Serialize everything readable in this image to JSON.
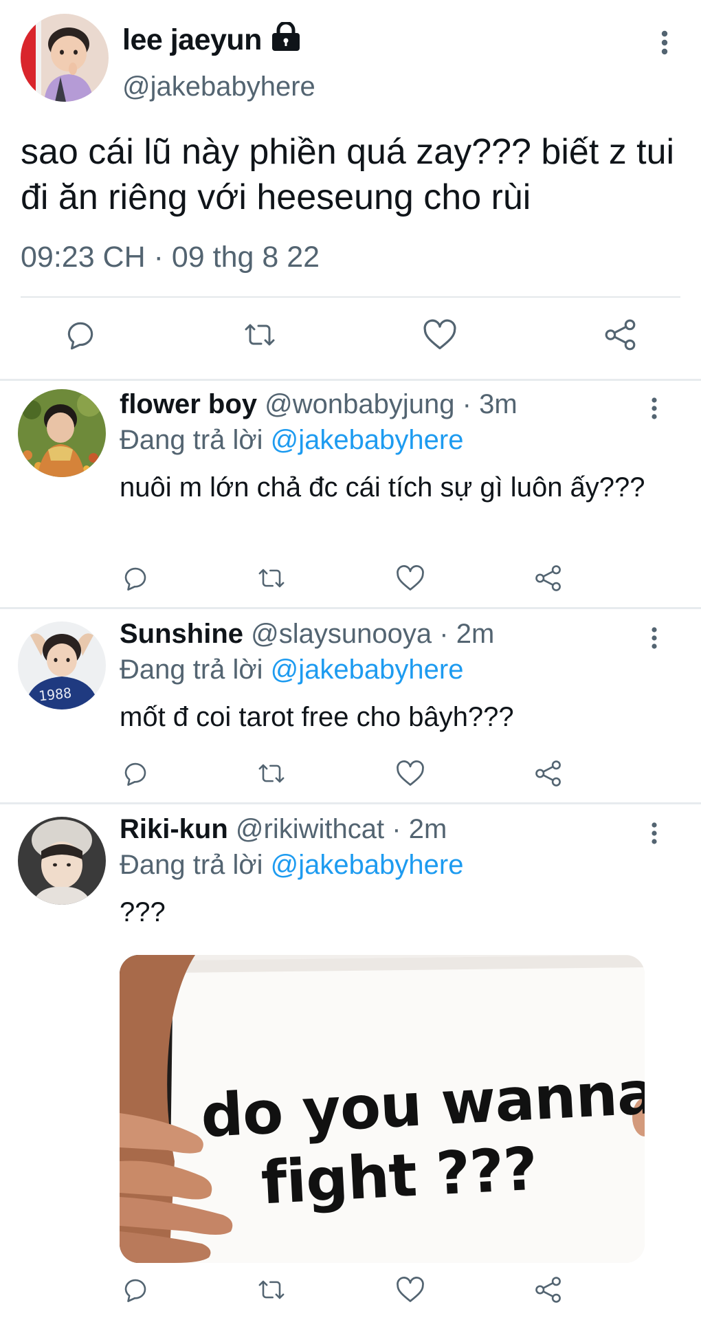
{
  "main_tweet": {
    "name": "lee jaeyun",
    "handle": "@jakebabyhere",
    "text": "sao cái lũ này phiền quá zay??? biết z tui đi ăn riêng với heeseung cho rùi",
    "timestamp": "09:23 CH · 09 thg 8 22",
    "icons": [
      "lock-icon",
      "more-icon",
      "reply-icon",
      "retweet-icon",
      "like-icon",
      "share-icon"
    ]
  },
  "replies": [
    {
      "name": "flower boy",
      "handle": "@wonbabyjung",
      "dot": "·",
      "time": "3m",
      "replying_prefix": "Đang trả lời",
      "replying_to": "@jakebabyhere",
      "text": "nuôi m lớn chả đc cái tích sự gì luôn ấy???"
    },
    {
      "name": "Sunshine",
      "handle": "@slaysunooya",
      "dot": "·",
      "time": "2m",
      "replying_prefix": "Đang trả lời",
      "replying_to": "@jakebabyhere",
      "text": "mốt đ coi tarot free cho bâyh???",
      "avatar_text": "1988"
    },
    {
      "name": "Riki-kun",
      "handle": "@rikiwithcat",
      "dot": "·",
      "time": "2m",
      "replying_prefix": "Đang trả lời",
      "replying_to": "@jakebabyhere",
      "text": "???",
      "media": {
        "line1": "do you wanna",
        "line2": "fight ???"
      }
    }
  ],
  "colors": {
    "text": "#0f1419",
    "secondary": "#536471",
    "link": "#1d9bf0",
    "divider": "#e7ebee"
  }
}
